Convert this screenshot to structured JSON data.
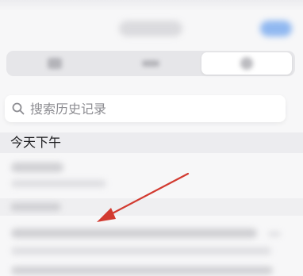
{
  "search": {
    "placeholder": "搜索历史记录"
  },
  "sections": {
    "today_afternoon": "今天下午"
  },
  "colors": {
    "accent": "#3a82f0",
    "annotation_arrow": "#d23a30"
  },
  "icons": {
    "search": "magnifier-icon"
  }
}
